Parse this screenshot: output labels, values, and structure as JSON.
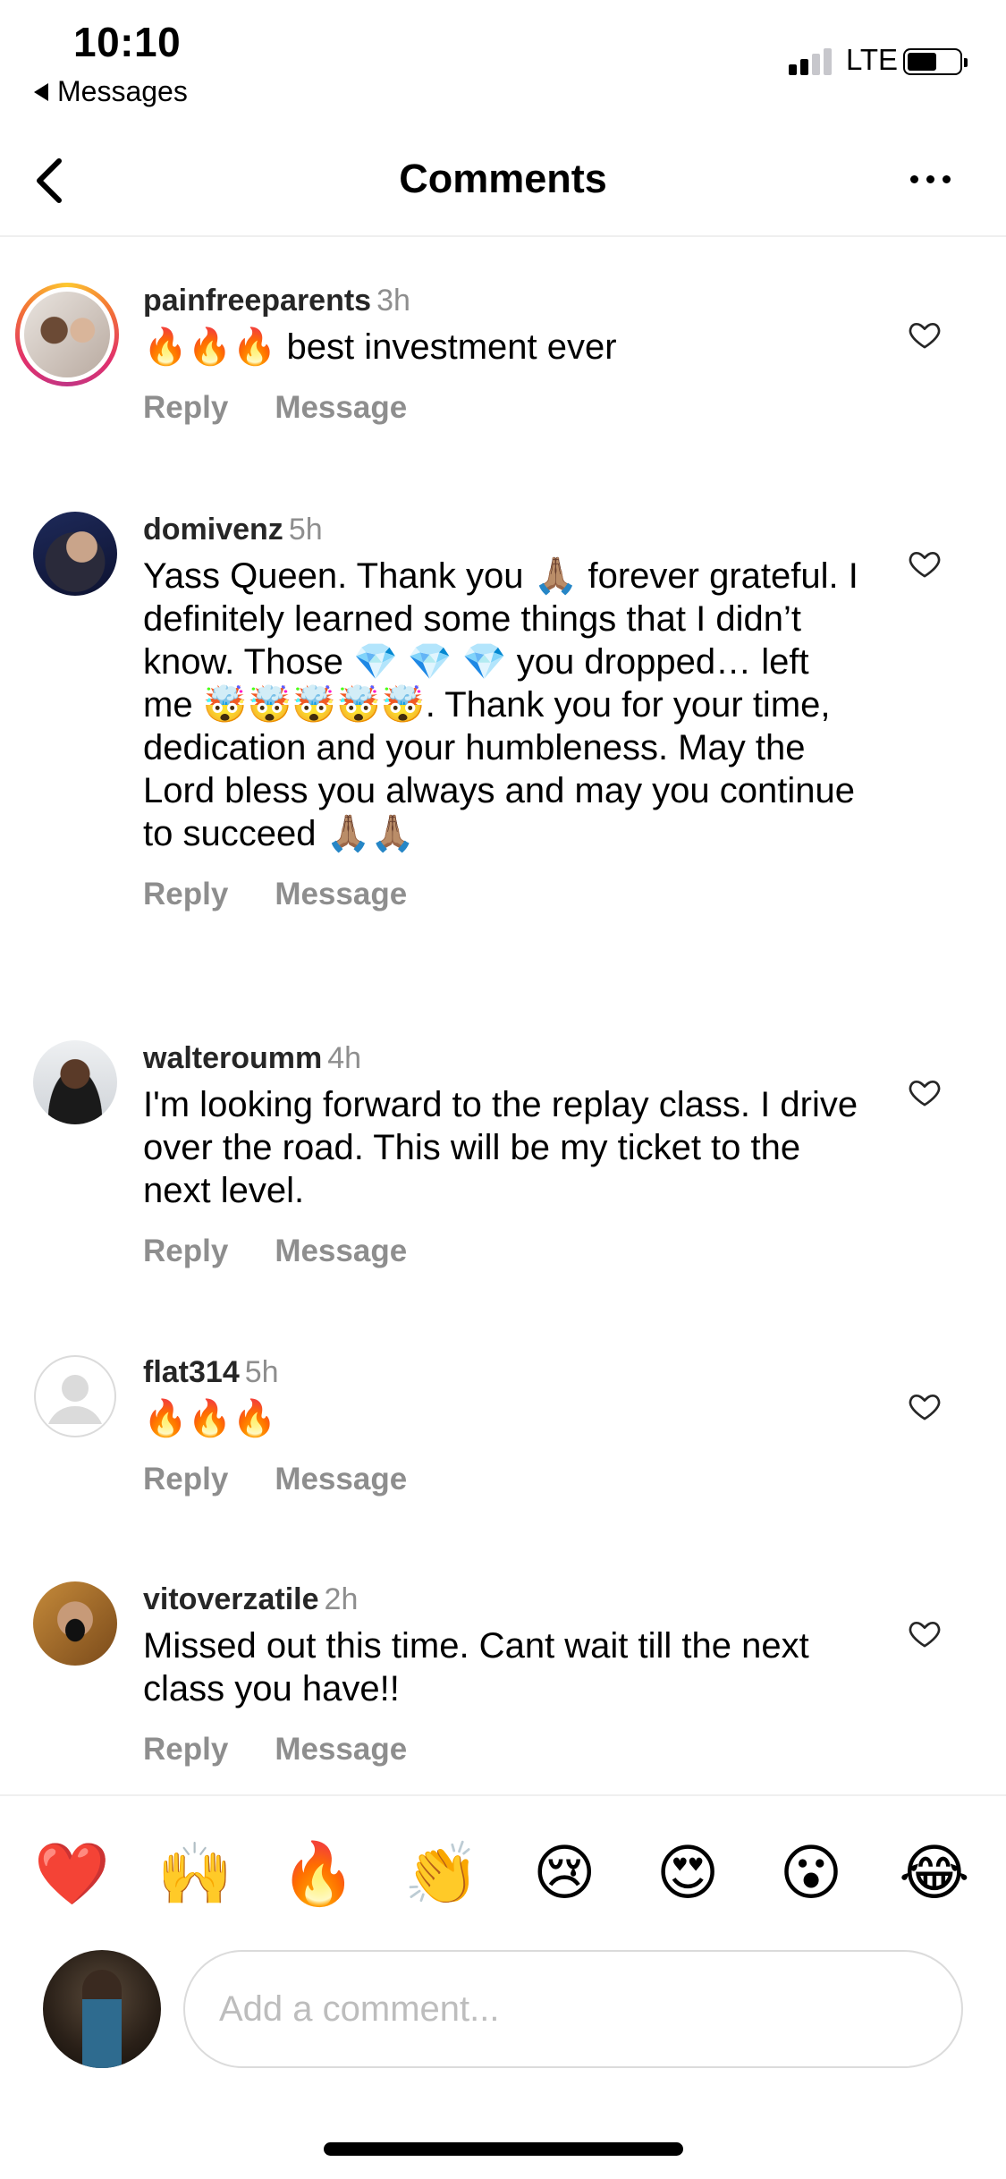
{
  "status_bar": {
    "time": "10:10",
    "back_app_label": "Messages",
    "network": "LTE"
  },
  "header": {
    "title": "Comments",
    "back_icon": "chevron-left-icon",
    "more_icon": "more-horizontal-icon"
  },
  "comments": [
    {
      "username": "painfreeparents",
      "time": "3h",
      "text": "🔥🔥🔥 best investment ever",
      "reply_label": "Reply",
      "message_label": "Message",
      "story_ring": true
    },
    {
      "username": "domivenz",
      "time": "5h",
      "text": "Yass Queen. Thank you 🙏🏽 forever grateful. I definitely learned some things that I didn’t know. Those 💎 💎 💎 you dropped… left me 🤯🤯🤯🤯🤯. Thank you for your time, dedication and your humbleness. May the Lord bless you always and may you continue to succeed 🙏🏽🙏🏽",
      "reply_label": "Reply",
      "message_label": "Message",
      "story_ring": false
    },
    {
      "username": "walteroumm",
      "time": "4h",
      "text": "I'm looking forward to the replay class. I drive over the road. This will be my ticket to the next level.",
      "reply_label": "Reply",
      "message_label": "Message",
      "story_ring": false
    },
    {
      "username": "flat314",
      "time": "5h",
      "text": "🔥🔥🔥",
      "reply_label": "Reply",
      "message_label": "Message",
      "story_ring": false
    },
    {
      "username": "vitoverzatile",
      "time": "2h",
      "text": "Missed out this time. Cant wait till the next class you have!!",
      "reply_label": "Reply",
      "message_label": "Message",
      "story_ring": false
    }
  ],
  "reactions": [
    "❤️",
    "🙌",
    "🔥",
    "👏",
    "😢",
    "😍",
    "😮",
    "😂"
  ],
  "composer": {
    "placeholder": "Add a comment..."
  },
  "colors": {
    "secondary_text": "#8e8e8e",
    "divider": "#efefef",
    "input_border": "#dbdbdb"
  }
}
